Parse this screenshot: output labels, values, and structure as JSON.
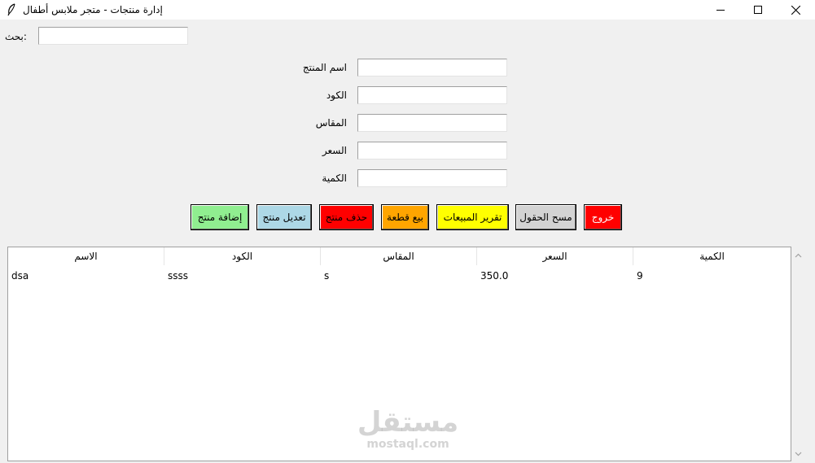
{
  "window": {
    "title": "إدارة منتجات - متجر ملابس أطفال",
    "icon": "feather-icon"
  },
  "search": {
    "label": "بحث:",
    "value": ""
  },
  "form": {
    "fields": [
      {
        "label": "اسم المنتج",
        "value": ""
      },
      {
        "label": "الكود",
        "value": ""
      },
      {
        "label": "المقاس",
        "value": ""
      },
      {
        "label": "السعر",
        "value": ""
      },
      {
        "label": "الكمية",
        "value": ""
      }
    ]
  },
  "buttons": [
    {
      "label": "إضافة منتج",
      "color": "#90ee90"
    },
    {
      "label": "تعديل منتج",
      "color": "#add8e6"
    },
    {
      "label": "حذف منتج",
      "color": "#ff0000"
    },
    {
      "label": "بيع قطعة",
      "color": "#ffa500"
    },
    {
      "label": "تقرير المبيعات",
      "color": "#ffff00"
    },
    {
      "label": "مسح الحقول",
      "color": "#d3d3d3"
    },
    {
      "label": "خروج",
      "color": "#ff0000",
      "text_color": "#ffffff"
    }
  ],
  "table": {
    "columns": [
      "الاسم",
      "الكود",
      "المقاس",
      "السعر",
      "الكمية"
    ],
    "rows": [
      [
        "dsa",
        "ssss",
        "s",
        "350.0",
        "9"
      ]
    ]
  },
  "watermark": {
    "main": "مستقل",
    "sub": "mostaql.com"
  }
}
